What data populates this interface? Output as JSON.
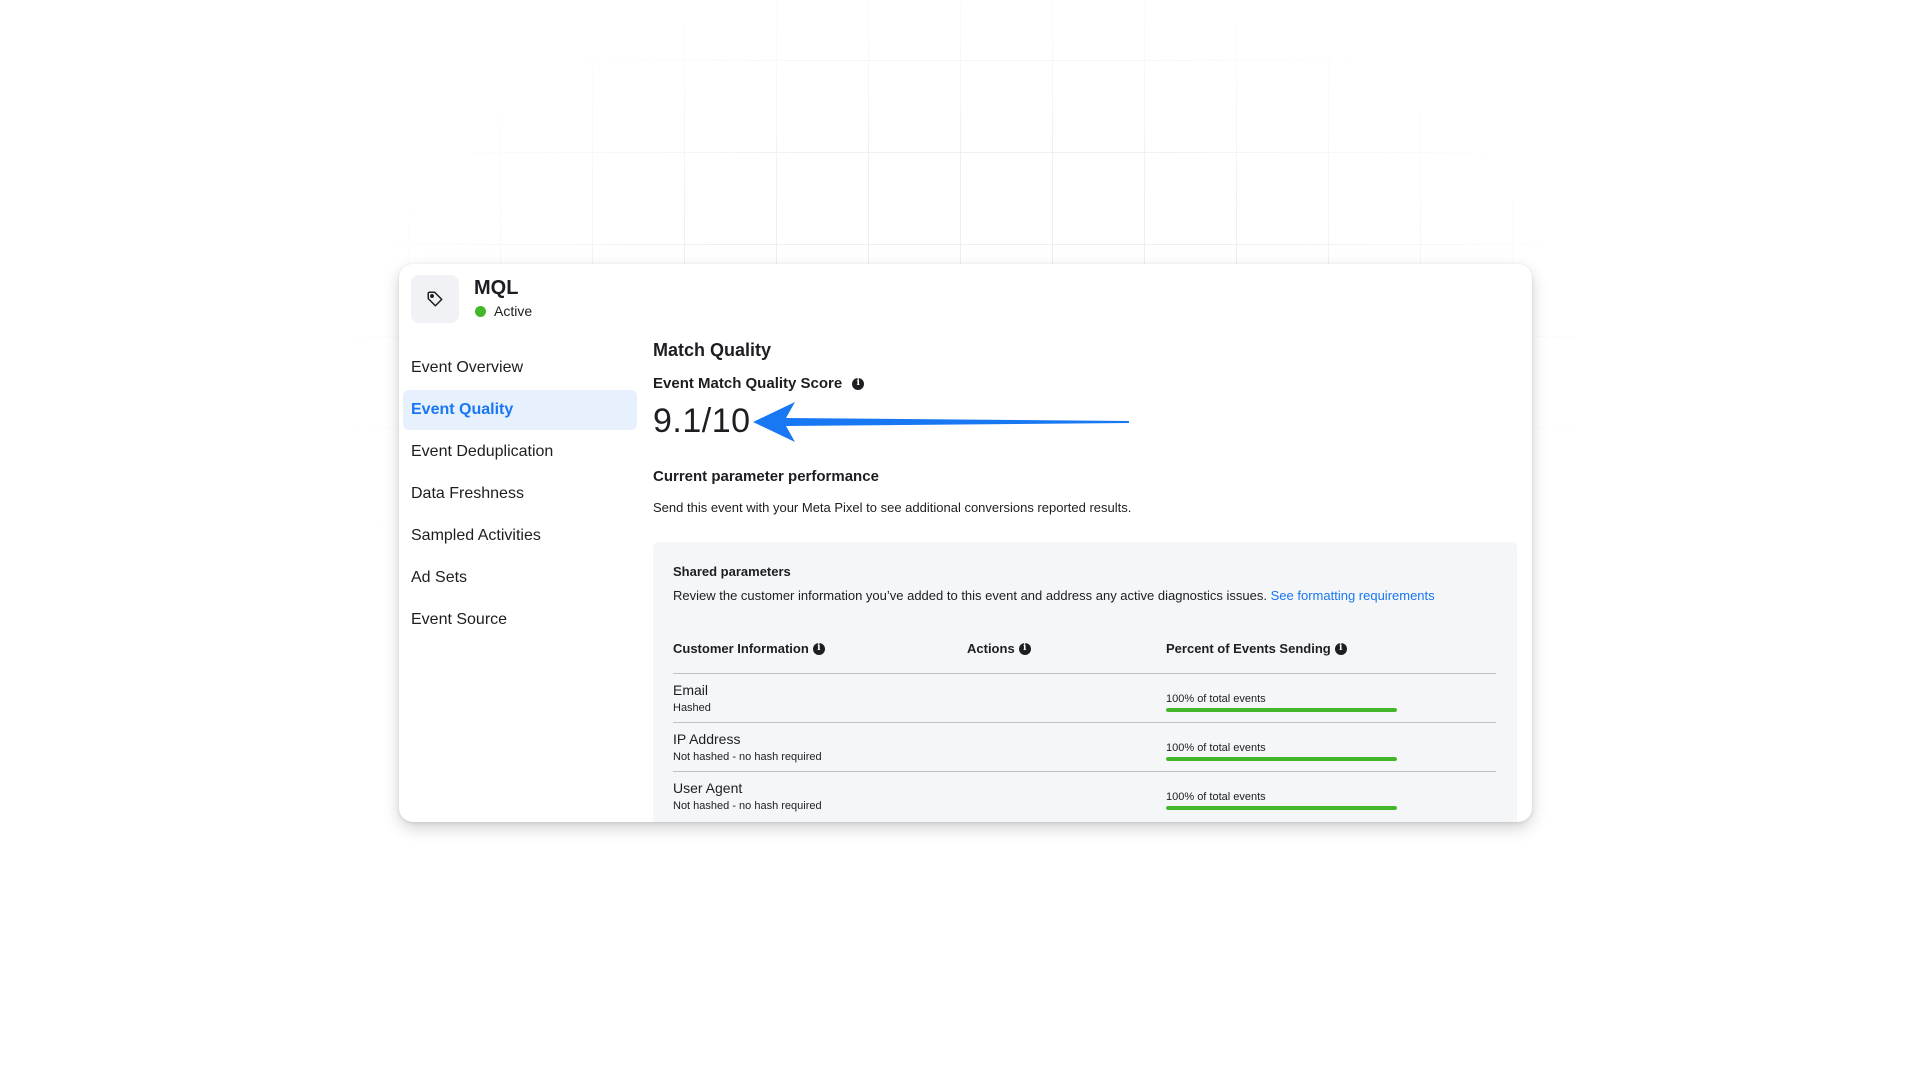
{
  "event": {
    "icon": "tag-icon",
    "title": "MQL",
    "status": "Active",
    "status_color": "#42b72a"
  },
  "sidebar": {
    "items": [
      {
        "label": "Event Overview",
        "active": false
      },
      {
        "label": "Event Quality",
        "active": true
      },
      {
        "label": "Event Deduplication",
        "active": false
      },
      {
        "label": "Data Freshness",
        "active": false
      },
      {
        "label": "Sampled Activities",
        "active": false
      },
      {
        "label": "Ad Sets",
        "active": false
      },
      {
        "label": "Event Source",
        "active": false
      }
    ]
  },
  "main": {
    "section_title": "Match Quality",
    "emq_label": "Event Match Quality Score",
    "score": "9.1/10",
    "perf_title": "Current parameter performance",
    "perf_desc": "Send this event with your Meta Pixel to see additional conversions reported results."
  },
  "panel": {
    "title": "Shared parameters",
    "desc": "Review the customer information you’ve added to this event and address any active diagnostics issues.",
    "link": "See formatting requirements",
    "columns": [
      "Customer Information",
      "Actions",
      "Percent of Events Sending"
    ],
    "rows": [
      {
        "name": "Email",
        "sub": "Hashed",
        "pct_label": "100% of total events",
        "pct": 1.0
      },
      {
        "name": "IP Address",
        "sub": "Not hashed - no hash required",
        "pct_label": "100% of total events",
        "pct": 1.0
      },
      {
        "name": "User Agent",
        "sub": "Not hashed - no hash required",
        "pct_label": "100% of total events",
        "pct": 1.0
      }
    ]
  },
  "colors": {
    "accent": "#1877f2",
    "arrow": "#1877f2",
    "progress": "#42b72a"
  }
}
